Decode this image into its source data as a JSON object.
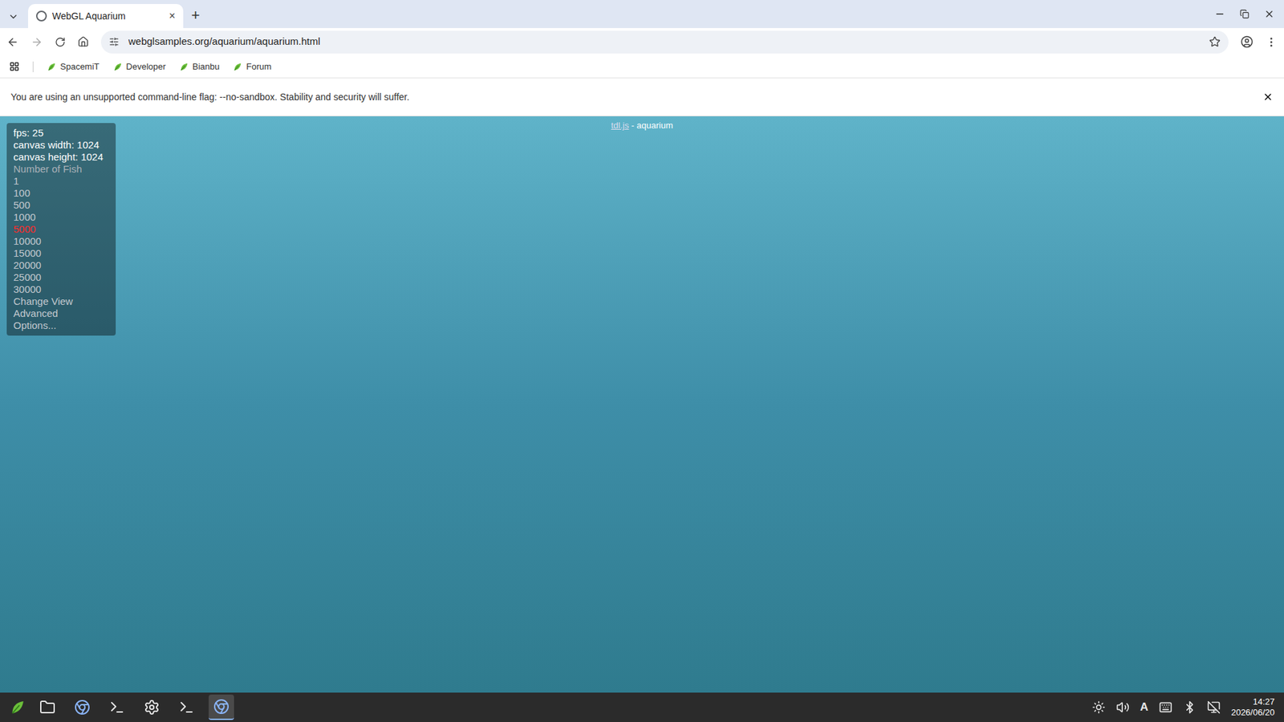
{
  "window": {
    "title": "WebGL Aquarium"
  },
  "tabs": [
    {
      "label": "WebGL Aquarium",
      "selected": true,
      "close": "×"
    }
  ],
  "new_tab": "+",
  "address_bar": {
    "url": "webglsamples.org/aquarium/aquarium.html"
  },
  "bookmarks": [
    "SpacemiT",
    "Developer",
    "Bianbu",
    "Forum"
  ],
  "info_bar": {
    "message": "You are using an unsupported command-line flag: --no-sandbox. Stability and security will suffer."
  },
  "page": {
    "header": {
      "link": "tdl.js",
      "separator": " - ",
      "title": "aquarium"
    },
    "stats": [
      "fps: 25",
      "canvas width: 1024",
      "canvas height: 1024"
    ],
    "fish_label": "Number of Fish",
    "fish_options": [
      {
        "label": "1",
        "selected": false
      },
      {
        "label": "100",
        "selected": false
      },
      {
        "label": "500",
        "selected": false
      },
      {
        "label": "1000",
        "selected": false
      },
      {
        "label": "5000",
        "selected": true
      },
      {
        "label": "10000",
        "selected": false
      },
      {
        "label": "15000",
        "selected": false
      },
      {
        "label": "20000",
        "selected": false
      },
      {
        "label": "25000",
        "selected": false
      },
      {
        "label": "30000",
        "selected": false
      }
    ],
    "links": [
      "Change View",
      "Advanced",
      "Options..."
    ]
  },
  "taskbar": {
    "apps": [
      {
        "kind": "files",
        "active": false
      },
      {
        "kind": "chrome",
        "active": false
      },
      {
        "kind": "terminal",
        "active": false
      },
      {
        "kind": "settings",
        "active": false
      },
      {
        "kind": "terminal",
        "active": false
      },
      {
        "kind": "chrome",
        "active": true
      }
    ],
    "input_method": "A",
    "time": "14:27",
    "date": "2026/06/20"
  }
}
